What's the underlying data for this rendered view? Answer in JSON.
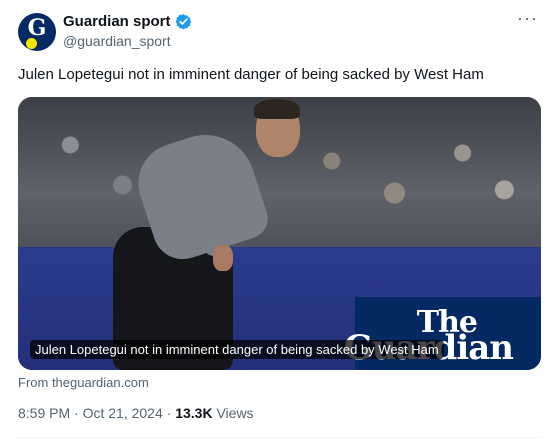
{
  "account": {
    "display_name": "Guardian sport",
    "handle": "@guardian_sport",
    "avatar_letter": "G",
    "verified_color": "#1d9bf0",
    "brand_color": "#052962"
  },
  "menu": {
    "more_label": "···"
  },
  "tweet": {
    "text": "Julen Lopetegui not in imminent danger of being sacked by West Ham"
  },
  "card": {
    "caption": "Julen Lopetegui not in imminent danger of being sacked by West Ham",
    "logo_line1": "The",
    "logo_line2": "Guardian",
    "source": "From theguardian.com"
  },
  "meta": {
    "time": "8:59 PM",
    "separator": " · ",
    "date": "Oct 21, 2024",
    "views_count": "13.3K",
    "views_label": "Views"
  }
}
